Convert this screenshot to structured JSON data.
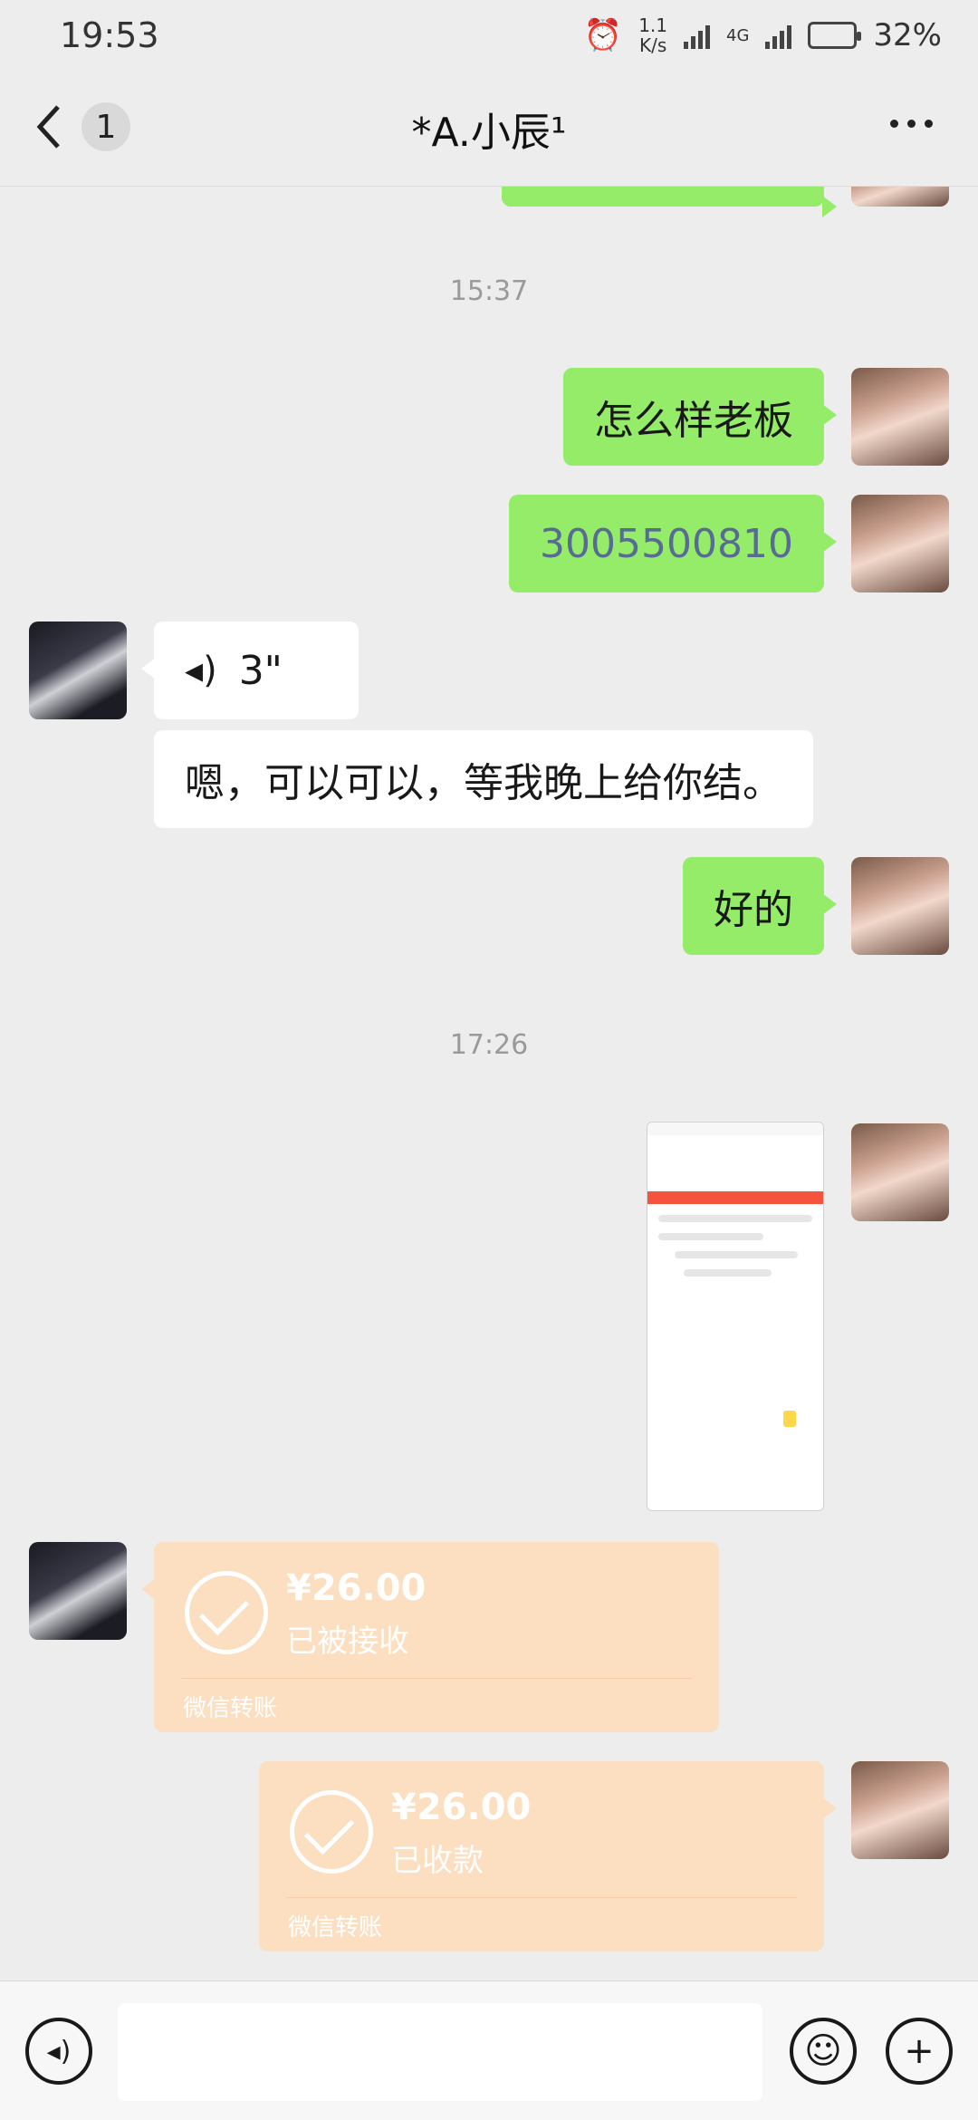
{
  "status_bar": {
    "time": "19:53",
    "net_speed_value": "1.1",
    "net_speed_unit": "K/s",
    "network_type": "4G",
    "battery": "32%"
  },
  "nav": {
    "unread_count": "1",
    "title": "*A.小辰¹"
  },
  "messages": {
    "time_1": "15:37",
    "msg_1": "怎么样老板",
    "msg_2": "3005500810",
    "voice_duration": "3\"",
    "msg_3": "嗯，可以可以，等我晚上给你结。",
    "msg_4": "好的",
    "time_2": "17:26"
  },
  "transfers": [
    {
      "amount": "¥26.00",
      "status": "已被接收",
      "label": "微信转账"
    },
    {
      "amount": "¥26.00",
      "status": "已收款",
      "label": "微信转账"
    }
  ],
  "colors": {
    "my_bubble": "#95ec69",
    "other_bubble": "#ffffff",
    "transfer_card": "#fbdfc0",
    "background": "#ededed"
  }
}
